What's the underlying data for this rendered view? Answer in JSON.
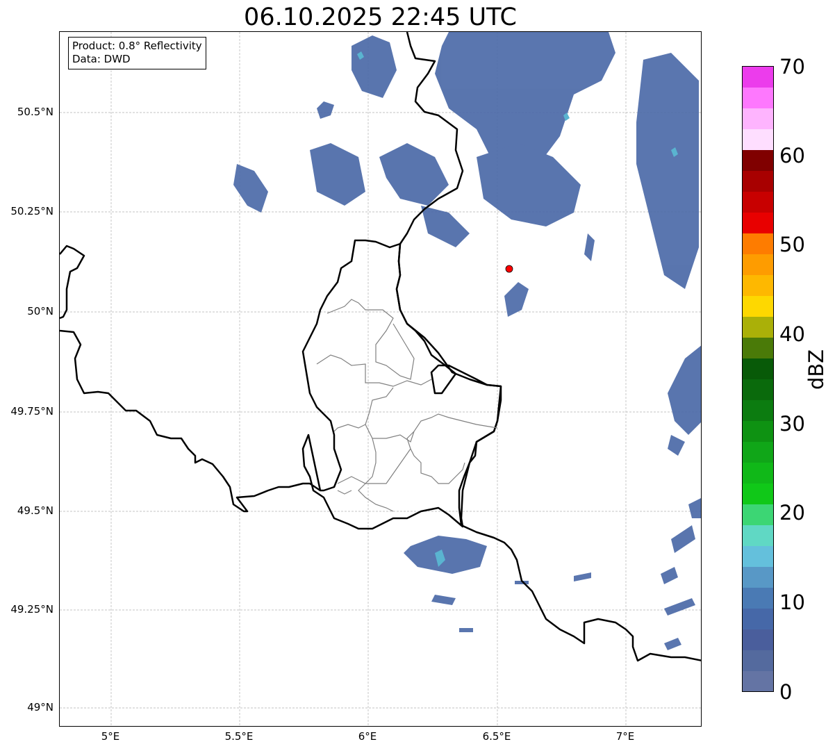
{
  "title": "06.10.2025 22:45 UTC",
  "info": {
    "product": "Product: 0.8° Reflectivity",
    "data": "Data: DWD"
  },
  "axes": {
    "lat_ticks": [
      "50.5°N",
      "50.25°N",
      "50°N",
      "49.75°N",
      "49.5°N",
      "49.25°N",
      "49°N"
    ],
    "lon_ticks": [
      "5°E",
      "5.5°E",
      "6°E",
      "6.5°E",
      "7°E"
    ],
    "lon_range": [
      4.8,
      7.3
    ],
    "lat_range": [
      48.95,
      50.7
    ]
  },
  "colorbar": {
    "label": "dBZ",
    "ticks": [
      "0",
      "10",
      "20",
      "30",
      "40",
      "50",
      "60",
      "70"
    ],
    "min": 0,
    "max": 70,
    "step": 2.5,
    "colors": [
      "#6474a4",
      "#546a9e",
      "#4a5e9c",
      "#4668a8",
      "#4a7ab4",
      "#5898c6",
      "#64c0dc",
      "#60d8c4",
      "#3cd674",
      "#10c818",
      "#10b818",
      "#10a618",
      "#0e9212",
      "#0c7c10",
      "#0a6a0c",
      "#085a08",
      "#4a7a08",
      "#aab008",
      "#fed800",
      "#feb800",
      "#fe9c00",
      "#fe7c00",
      "#e80000",
      "#c80000",
      "#a80000",
      "#800000",
      "#fedeff",
      "#feb4fe",
      "#fe78fe",
      "#ec3cec"
    ]
  },
  "radar_site_color": "#ff0000",
  "grid": true
}
